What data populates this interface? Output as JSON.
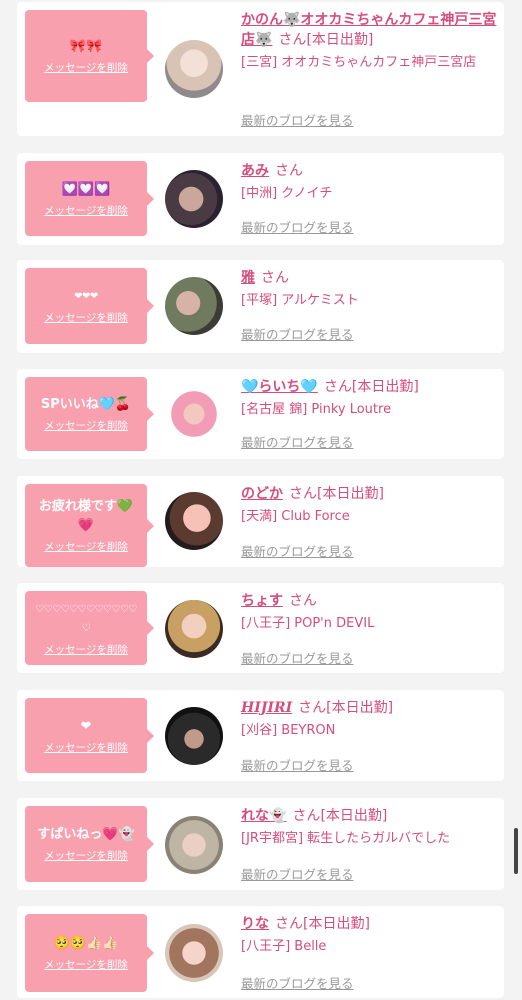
{
  "delete_label": "メッセージを削除",
  "blog_label": "最新のブログを見る",
  "san_label": "さん",
  "colors": {
    "bubble": "#f8a0ae",
    "accent": "#d64d7c",
    "blog": "#999999"
  },
  "cards": [
    {
      "message": "🎀🎀",
      "name": "かのん🐺オオカミちゃんカフェ神戸三宮店🐺",
      "status": "[本日出勤]",
      "shop": "[三宮] オオカミちゃんカフェ神戸三宮店"
    },
    {
      "message": "💟💟💟",
      "name": "あみ",
      "status": "",
      "shop": "[中洲] クノイチ"
    },
    {
      "message": "❤❤❤",
      "name": "雅",
      "status": "",
      "shop": "[平塚] アルケミスト"
    },
    {
      "message": "SPいいね🩵🍒",
      "name": "🩵らいち🩵",
      "status": "[本日出勤]",
      "shop": "[名古屋 錦] Pinky Loutre"
    },
    {
      "message": "お疲れ様です💚💗",
      "name": "のどか",
      "status": "[本日出勤]",
      "shop": "[天満] Club Force"
    },
    {
      "message": "♡♡♡♡♡♡♡♡♡♡♡♡♡",
      "name": "ちょす",
      "status": "",
      "shop": "[八王子] POP'n DEVIL"
    },
    {
      "message": "❤",
      "name": "HIJIRI",
      "status": "[本日出勤]",
      "shop": "[刈谷] BEYRON"
    },
    {
      "message": "すぱいねっ💗👻",
      "name": "れな👻",
      "status": "[本日出勤]",
      "shop": "[JR宇都宮] 転生したらガルバでした"
    },
    {
      "message": "🥺🥺👍🏻👍🏻",
      "name": "りな",
      "status": "[本日出勤]",
      "shop": "[八王子] Belle"
    }
  ]
}
